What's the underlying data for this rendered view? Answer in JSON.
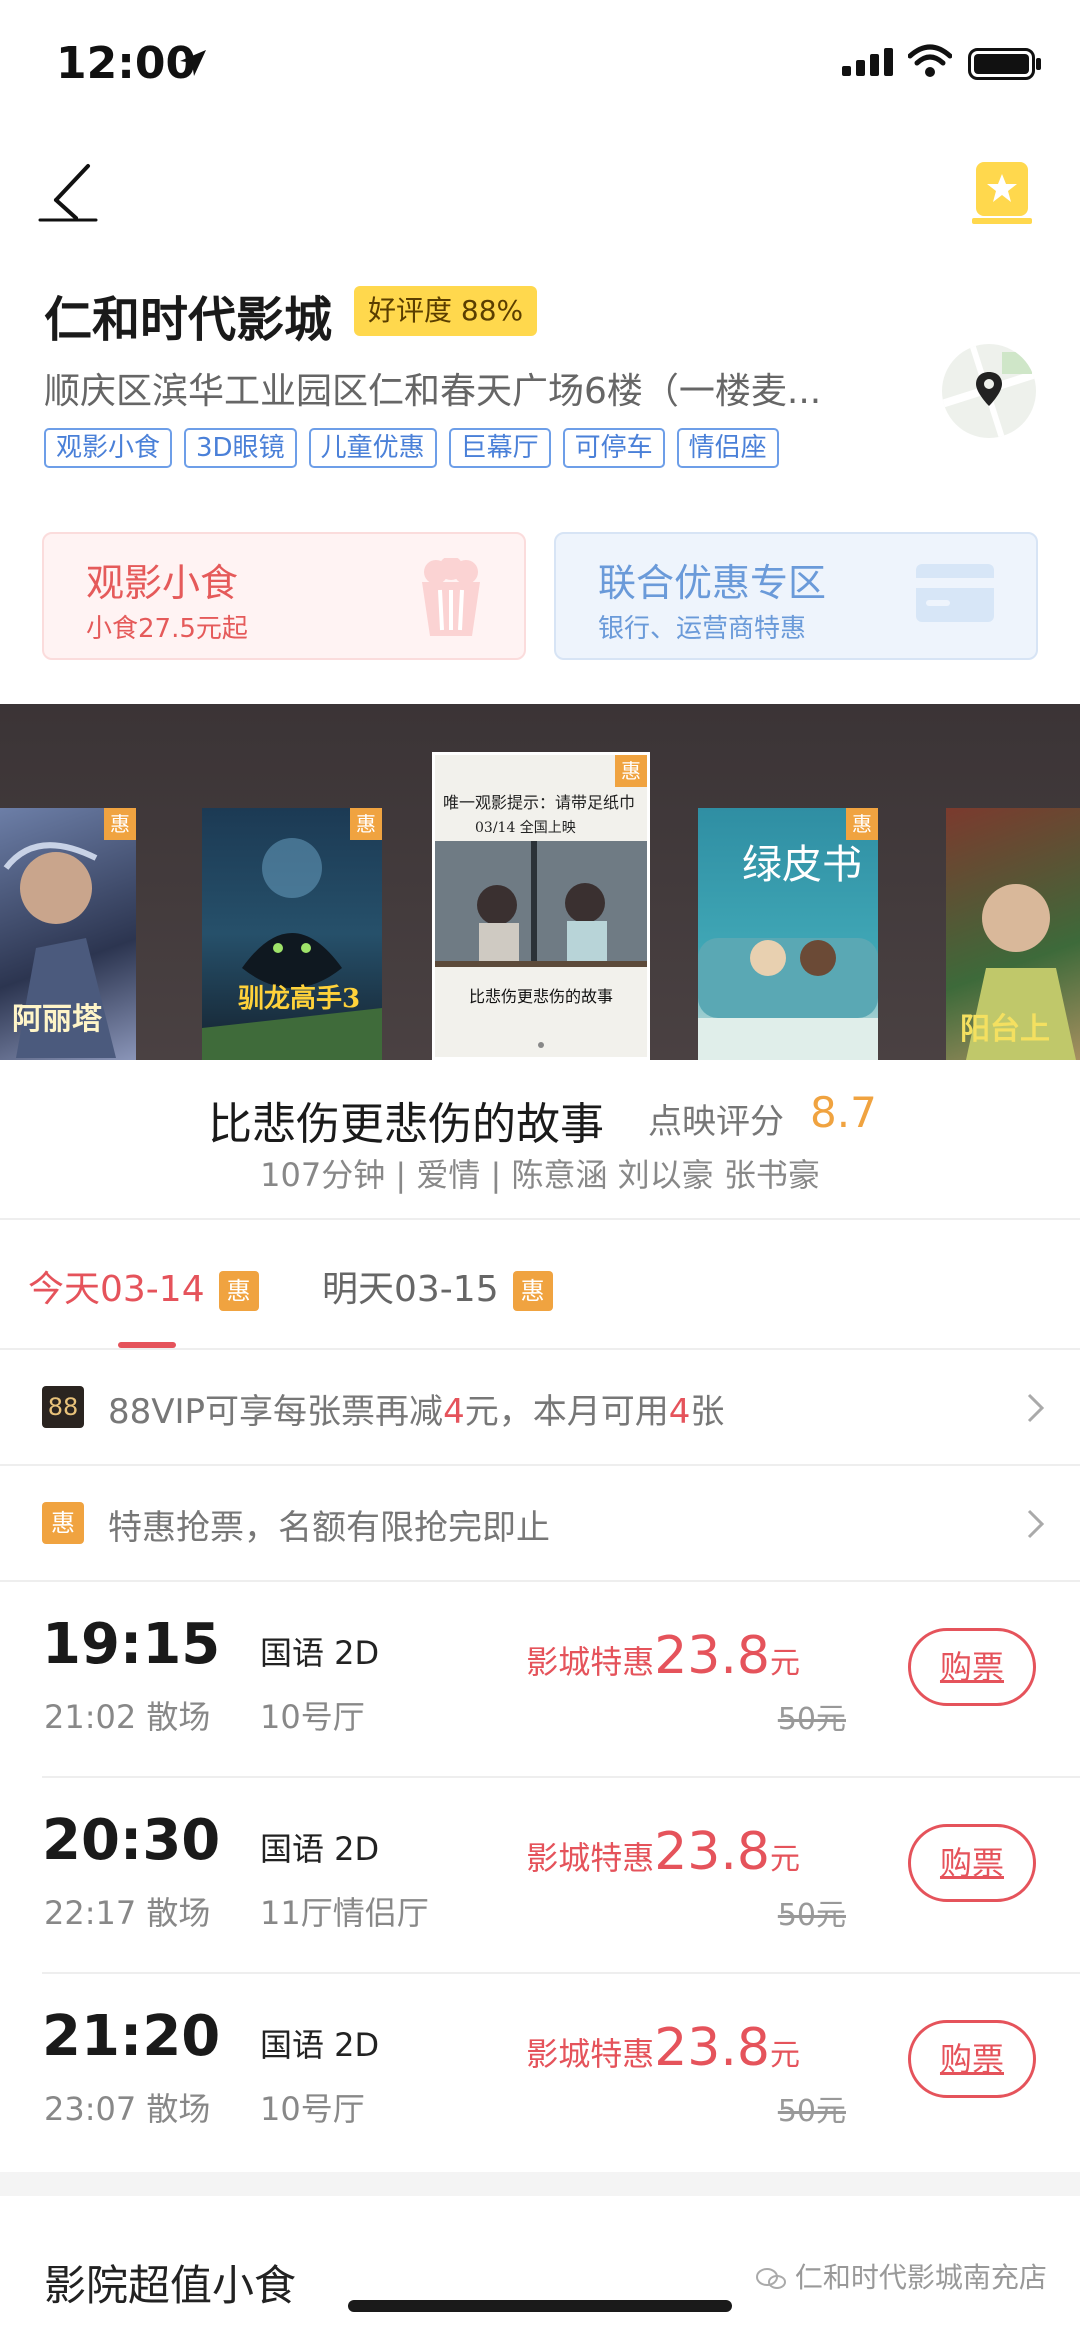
{
  "status": {
    "time": "12:00"
  },
  "cinema": {
    "name": "仁和时代影城",
    "rating_badge": "好评度 88%",
    "address": "顺庆区滨华工业园区仁和春天广场6楼（一楼麦...",
    "tags": [
      "观影小食",
      "3D眼镜",
      "儿童优惠",
      "巨幕厅",
      "可停车",
      "情侣座"
    ]
  },
  "promos": [
    {
      "title": "观影小食",
      "subtitle": "小食27.5元起"
    },
    {
      "title": "联合优惠专区",
      "subtitle": "银行、运营商特惠"
    }
  ],
  "posters": {
    "badge": "惠",
    "titles": [
      "阿丽塔",
      "驯龙高手3",
      "",
      "绿皮书",
      "阳台上"
    ],
    "active_top_text": "唯一观影提示：请带足纸巾",
    "active_date_text": "03/14 全国上映",
    "active_bottom_text": "比悲伤更悲伤的故事"
  },
  "movie": {
    "title": "比悲伤更悲伤的故事",
    "score_label": "点映评分",
    "score": "8.7",
    "meta": "107分钟 | 爱情 | 陈意涵 刘以豪 张书豪"
  },
  "tabs": [
    {
      "label": "今天03-14",
      "badge": "惠",
      "active": true
    },
    {
      "label": "明天03-15",
      "badge": "惠",
      "active": false
    }
  ],
  "notices": [
    {
      "icon": "88",
      "text_a": "88VIP可享每张票再减",
      "hl1": "4",
      "text_b": "元，本月可用",
      "hl2": "4",
      "text_c": "张"
    },
    {
      "icon": "惠",
      "text": "特惠抢票，名额有限抢完即止"
    }
  ],
  "showtimes": [
    {
      "start": "19:15",
      "end": "21:02 散场",
      "lang": "国语 2D",
      "hall": "10号厅",
      "price_label": "影城特惠",
      "price": "23.8",
      "unit": "元",
      "original": "50元",
      "buy": "购票"
    },
    {
      "start": "20:30",
      "end": "22:17 散场",
      "lang": "国语 2D",
      "hall": "11厅情侣厅",
      "price_label": "影城特惠",
      "price": "23.8",
      "unit": "元",
      "original": "50元",
      "buy": "购票"
    },
    {
      "start": "21:20",
      "end": "23:07 散场",
      "lang": "国语 2D",
      "hall": "10号厅",
      "price_label": "影城特惠",
      "price": "23.8",
      "unit": "元",
      "original": "50元",
      "buy": "购票"
    }
  ],
  "snacks_section": {
    "title": "影院超值小食"
  },
  "watermark": "仁和时代影城南充店",
  "colors": {
    "accent_red": "#e5535b",
    "accent_orange": "#f0a340",
    "tag_blue": "#4a80d8"
  }
}
